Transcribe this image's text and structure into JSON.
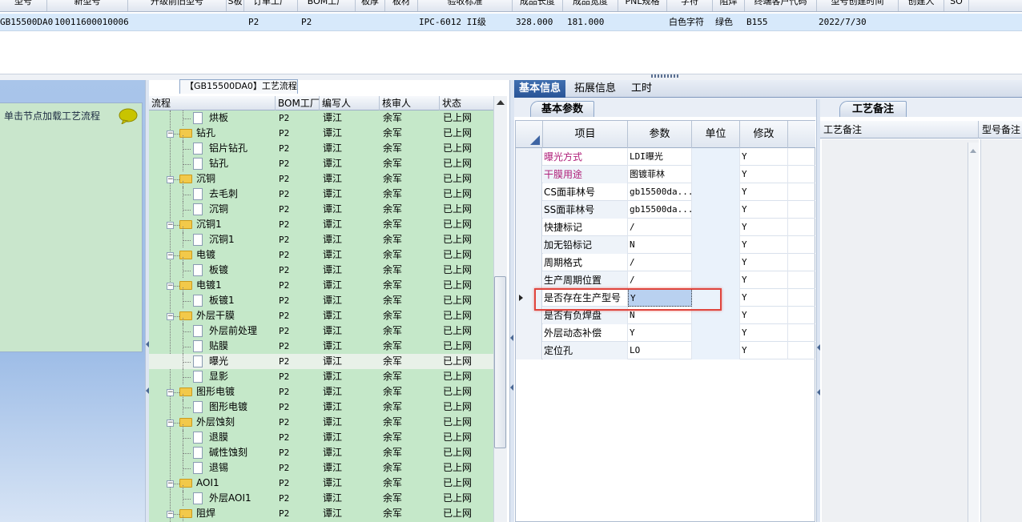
{
  "top_grid": {
    "headers": [
      "型号",
      "新型号",
      "升级前旧型号",
      "S板",
      "订单工厂",
      "BOM工厂",
      "板厚",
      "板材",
      "验收标准",
      "成品长度",
      "成品宽度",
      "PNL规格",
      "字符",
      "阻焊",
      "终端客户代码",
      "型号创建时间",
      "创建人",
      "SO"
    ],
    "row": {
      "model": "GB15500DA0",
      "new_model": "10011600010006",
      "order_factory": "P2",
      "bom_factory": "P2",
      "standard": "IPC-6012 II级",
      "length": "328.000",
      "width": "181.000",
      "char": "白色字符",
      "mask": "绿色",
      "customer": "B155",
      "created": "2022/7/30"
    }
  },
  "left_hint": {
    "text": "单击节点加载工艺流程",
    "icon": "speech-bubble-icon"
  },
  "tree": {
    "title": "【GB15500DA0】工艺流程",
    "columns": [
      "流程",
      "BOM工厂",
      "编写人",
      "核审人",
      "状态"
    ],
    "rows": [
      {
        "name": "烘板",
        "level": 2,
        "factory": "P2",
        "writer": "谭江",
        "reviewer": "余军",
        "status": "已上网"
      },
      {
        "name": "钻孔",
        "level": 1,
        "factory": "P2",
        "writer": "谭江",
        "reviewer": "余军",
        "status": "已上网"
      },
      {
        "name": "铝片钻孔",
        "level": 2,
        "factory": "P2",
        "writer": "谭江",
        "reviewer": "余军",
        "status": "已上网"
      },
      {
        "name": "钻孔",
        "level": 2,
        "factory": "P2",
        "writer": "谭江",
        "reviewer": "余军",
        "status": "已上网"
      },
      {
        "name": "沉铜",
        "level": 1,
        "factory": "P2",
        "writer": "谭江",
        "reviewer": "余军",
        "status": "已上网"
      },
      {
        "name": "去毛刺",
        "level": 2,
        "factory": "P2",
        "writer": "谭江",
        "reviewer": "余军",
        "status": "已上网"
      },
      {
        "name": "沉铜",
        "level": 2,
        "factory": "P2",
        "writer": "谭江",
        "reviewer": "余军",
        "status": "已上网"
      },
      {
        "name": "沉铜1",
        "level": 1,
        "factory": "P2",
        "writer": "谭江",
        "reviewer": "余军",
        "status": "已上网"
      },
      {
        "name": "沉铜1",
        "level": 2,
        "factory": "P2",
        "writer": "谭江",
        "reviewer": "余军",
        "status": "已上网"
      },
      {
        "name": "电镀",
        "level": 1,
        "factory": "P2",
        "writer": "谭江",
        "reviewer": "余军",
        "status": "已上网"
      },
      {
        "name": "板镀",
        "level": 2,
        "factory": "P2",
        "writer": "谭江",
        "reviewer": "余军",
        "status": "已上网"
      },
      {
        "name": "电镀1",
        "level": 1,
        "factory": "P2",
        "writer": "谭江",
        "reviewer": "余军",
        "status": "已上网"
      },
      {
        "name": "板镀1",
        "level": 2,
        "factory": "P2",
        "writer": "谭江",
        "reviewer": "余军",
        "status": "已上网"
      },
      {
        "name": "外层干膜",
        "level": 1,
        "factory": "P2",
        "writer": "谭江",
        "reviewer": "余军",
        "status": "已上网"
      },
      {
        "name": "外层前处理",
        "level": 2,
        "factory": "P2",
        "writer": "谭江",
        "reviewer": "余军",
        "status": "已上网"
      },
      {
        "name": "贴膜",
        "level": 2,
        "factory": "P2",
        "writer": "谭江",
        "reviewer": "余军",
        "status": "已上网"
      },
      {
        "name": "曝光",
        "level": 2,
        "factory": "P2",
        "writer": "谭江",
        "reviewer": "余军",
        "status": "已上网",
        "selected": true
      },
      {
        "name": "显影",
        "level": 2,
        "factory": "P2",
        "writer": "谭江",
        "reviewer": "余军",
        "status": "已上网"
      },
      {
        "name": "图形电镀",
        "level": 1,
        "factory": "P2",
        "writer": "谭江",
        "reviewer": "余军",
        "status": "已上网"
      },
      {
        "name": "图形电镀",
        "level": 2,
        "factory": "P2",
        "writer": "谭江",
        "reviewer": "余军",
        "status": "已上网"
      },
      {
        "name": "外层蚀刻",
        "level": 1,
        "factory": "P2",
        "writer": "谭江",
        "reviewer": "余军",
        "status": "已上网"
      },
      {
        "name": "退膜",
        "level": 2,
        "factory": "P2",
        "writer": "谭江",
        "reviewer": "余军",
        "status": "已上网"
      },
      {
        "name": "碱性蚀刻",
        "level": 2,
        "factory": "P2",
        "writer": "谭江",
        "reviewer": "余军",
        "status": "已上网"
      },
      {
        "name": "退锡",
        "level": 2,
        "factory": "P2",
        "writer": "谭江",
        "reviewer": "余军",
        "status": "已上网"
      },
      {
        "name": "AOI1",
        "level": 1,
        "factory": "P2",
        "writer": "谭江",
        "reviewer": "余军",
        "status": "已上网"
      },
      {
        "name": "外层AOI1",
        "level": 2,
        "factory": "P2",
        "writer": "谭江",
        "reviewer": "余军",
        "status": "已上网"
      },
      {
        "name": "阻焊",
        "level": 1,
        "factory": "P2",
        "writer": "谭江",
        "reviewer": "余军",
        "status": "已上网"
      }
    ]
  },
  "tabs": [
    "基本信息",
    "拓展信息",
    "工时"
  ],
  "subtabs": {
    "params": "基本参数",
    "notes": "工艺备注"
  },
  "params": {
    "columns": [
      "项目",
      "参数",
      "单位",
      "修改"
    ],
    "rows": [
      {
        "item": "曝光方式",
        "value": "LDI曝光",
        "unit": "",
        "mod": "Y",
        "pink": true
      },
      {
        "item": "干膜用途",
        "value": "图镀菲林",
        "unit": "",
        "mod": "Y",
        "pink": true
      },
      {
        "item": "CS面菲林号",
        "value": "gb15500da...",
        "unit": "",
        "mod": "Y"
      },
      {
        "item": "SS面菲林号",
        "value": "gb15500da...",
        "unit": "",
        "mod": "Y"
      },
      {
        "item": "快捷标记",
        "value": "/",
        "unit": "",
        "mod": "Y"
      },
      {
        "item": "加无铅标记",
        "value": "N",
        "unit": "",
        "mod": "Y"
      },
      {
        "item": "周期格式",
        "value": "/",
        "unit": "",
        "mod": "Y"
      },
      {
        "item": "生产周期位置",
        "value": "/",
        "unit": "",
        "mod": "Y"
      },
      {
        "item": "是否存在生产型号",
        "value": "Y",
        "unit": "",
        "mod": "Y",
        "current": true
      },
      {
        "item": "是否有负焊盘",
        "value": "N",
        "unit": "",
        "mod": "Y"
      },
      {
        "item": "外层动态补偿",
        "value": "Y",
        "unit": "",
        "mod": "Y"
      },
      {
        "item": "定位孔",
        "value": "LO",
        "unit": "",
        "mod": "Y"
      }
    ]
  },
  "notes": {
    "col1": "工艺备注",
    "col2": "型号备注"
  },
  "colors": {
    "accent": "#2a5597",
    "highlight": "#e0453d",
    "tree_bg": "#c5e8c9",
    "row_bg": "#d7e9fb",
    "pink": "#b0207a"
  }
}
